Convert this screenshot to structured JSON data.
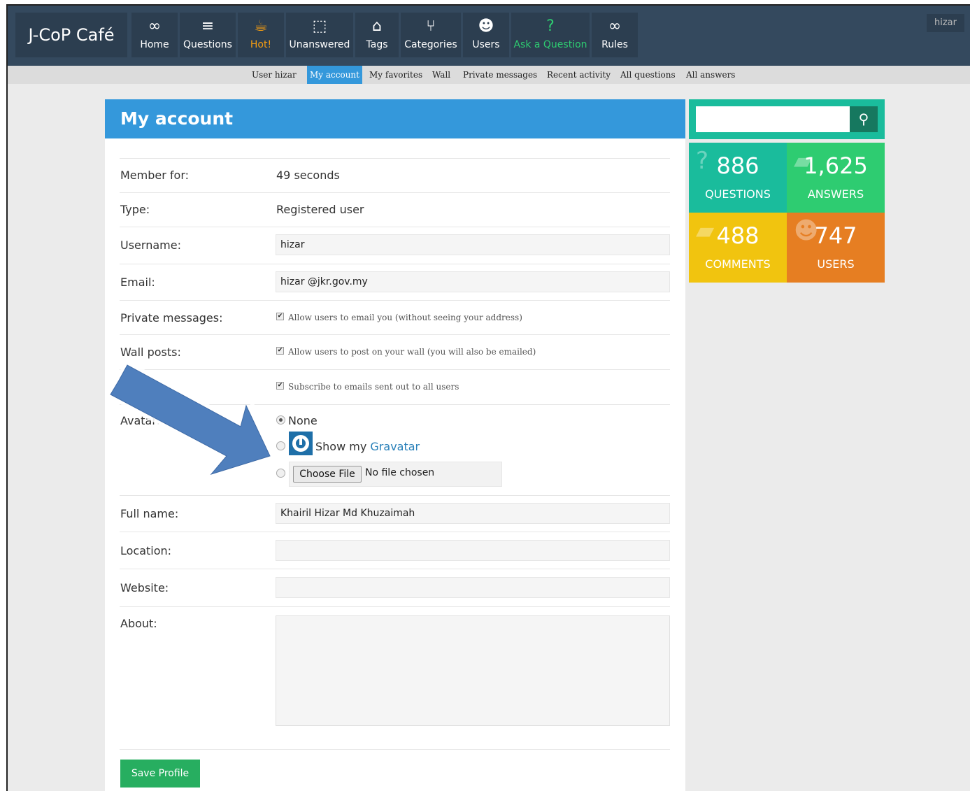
{
  "user_chip": "hizar",
  "logo": "J-CoP Café",
  "nav": [
    {
      "label": "Home",
      "icon": "infinity-icon",
      "glyph": "∞"
    },
    {
      "label": "Questions",
      "icon": "list-icon",
      "glyph": "≡"
    },
    {
      "label": "Hot!",
      "icon": "coffee-icon",
      "glyph": "☕"
    },
    {
      "label": "Unanswered",
      "icon": "bookmark-icon",
      "glyph": "⬚"
    },
    {
      "label": "Tags",
      "icon": "tag-icon",
      "glyph": "⌂"
    },
    {
      "label": "Categories",
      "icon": "branch-icon",
      "glyph": "⑂"
    },
    {
      "label": "Users",
      "icon": "users-icon",
      "glyph": "☻"
    },
    {
      "label": "Ask a Question",
      "icon": "question-icon",
      "glyph": "?"
    },
    {
      "label": "Rules",
      "icon": "infinity-icon",
      "glyph": "∞"
    }
  ],
  "subnav": [
    "User hizar",
    "My account",
    "My favorites",
    "Wall",
    "Private messages",
    "Recent activity",
    "All questions",
    "All answers"
  ],
  "page_title": "My account",
  "form": {
    "member_for_label": "Member for:",
    "member_for_value": "49 seconds",
    "type_label": "Type:",
    "type_value": "Registered user",
    "username_label": "Username:",
    "username_value": "hizar",
    "email_label": "Email:",
    "email_value": "hizar  @jkr.gov.my",
    "private_messages_label": "Private messages:",
    "private_messages_option": "Allow users to email you (without seeing your address)",
    "wall_posts_label": "Wall posts:",
    "wall_posts_option": "Allow users to post on your wall (you will also be emailed)",
    "mass_mail_option": "Subscribe to emails sent out to all users",
    "avatar_label": "Avatar:",
    "avatar_none": "None",
    "avatar_gravatar_prefix": "Show my",
    "avatar_gravatar_link": "Gravatar",
    "file_button": "Choose File",
    "file_status": "No file chosen",
    "fullname_label": "Full name:",
    "fullname_value": "Khairil Hizar Md Khuzaimah",
    "location_label": "Location:",
    "location_value": "",
    "website_label": "Website:",
    "website_value": "",
    "about_label": "About:",
    "about_value": "",
    "save_button": "Save Profile"
  },
  "stats": [
    {
      "number": "886",
      "label": "QUESTIONS",
      "color": "#1abc9c",
      "icon": "question-icon",
      "glyph": "?"
    },
    {
      "number": "1,625",
      "label": "ANSWERS",
      "color": "#2ecc71",
      "icon": "comment-icon",
      "glyph": "▰"
    },
    {
      "number": "488",
      "label": "COMMENTS",
      "color": "#f1c40f",
      "icon": "comments-icon",
      "glyph": "▰"
    },
    {
      "number": "747",
      "label": "USERS",
      "color": "#e67e22",
      "icon": "users-icon",
      "glyph": "☻"
    }
  ],
  "colors": {
    "topbar": "#34495e",
    "nav_item": "#2c3e50",
    "accent_blue": "#3498db",
    "hot": "#f39c12",
    "ask": "#2ecc71",
    "save": "#27ae60",
    "arrow": "#4f7fbd"
  }
}
